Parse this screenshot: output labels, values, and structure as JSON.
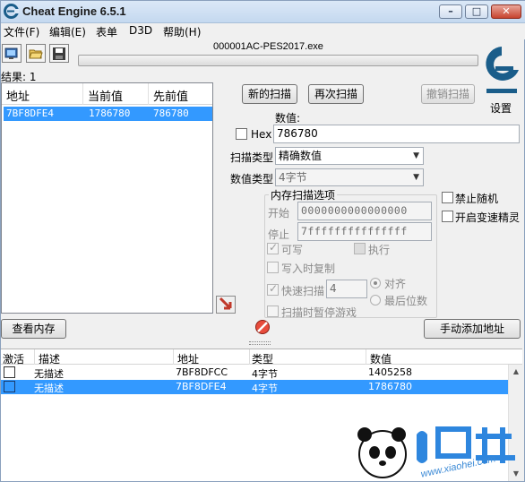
{
  "window": {
    "title": "Cheat Engine 6.5.1",
    "minimize_glyph": "–",
    "maximize_glyph": "□",
    "close_glyph": "✕"
  },
  "menu": [
    "文件(F)",
    "编辑(E)",
    "表单",
    "D3D",
    "帮助(H)"
  ],
  "toolbar": {
    "icons": [
      "open-process-icon",
      "open-file-icon",
      "save-icon"
    ],
    "process_name": "000001AC-PES2017.exe",
    "progress_percent": 0
  },
  "found": {
    "label": "结果: ",
    "count": "1"
  },
  "logo": {
    "settings_label": "设置"
  },
  "results": {
    "columns": [
      "地址",
      "当前值",
      "先前值"
    ],
    "rows": [
      {
        "address": "7BF8DFE4",
        "current": "1786780",
        "previous": "786780"
      }
    ]
  },
  "scan": {
    "new_scan": "新的扫描",
    "next_scan": "再次扫描",
    "undo_scan": "撤销扫描",
    "value_label": "数值:",
    "hex_label": "Hex",
    "value": "786780",
    "scan_type_label": "扫描类型",
    "scan_type": "精确数值",
    "value_type_label": "数值类型",
    "value_type": "4字节"
  },
  "memory_options": {
    "title": "内存扫描选项",
    "start_label": "开始",
    "start_value": "0000000000000000",
    "stop_label": "停止",
    "stop_value": "7fffffffffffffff",
    "writable": "可写",
    "executable": "执行",
    "copy_on_write": "写入时复制",
    "fast_scan": "快速扫描",
    "fast_scan_value": "4",
    "align": "对齐",
    "last_digits": "最后位数",
    "pause_game": "扫描时暂停游戏"
  },
  "side_options": {
    "no_random": "禁止随机",
    "speedhack": "开启变速精灵"
  },
  "bottom_buttons": {
    "view_memory": "查看内存",
    "add_address": "手动添加地址"
  },
  "address_list": {
    "columns": [
      "激活",
      "描述",
      "地址",
      "类型",
      "数值"
    ],
    "rows": [
      {
        "desc": "无描述",
        "address": "7BF8DFCC",
        "type": "4字节",
        "value": "1405258",
        "selected": false
      },
      {
        "desc": "无描述",
        "address": "7BF8DFE4",
        "type": "4字节",
        "value": "1786780",
        "selected": true
      }
    ]
  },
  "colors": {
    "selection": "#3399ff",
    "logo": "#1a5d8a",
    "watermark": "#3b8ad6"
  },
  "watermark": {
    "text": "www.xiaohei.com"
  }
}
